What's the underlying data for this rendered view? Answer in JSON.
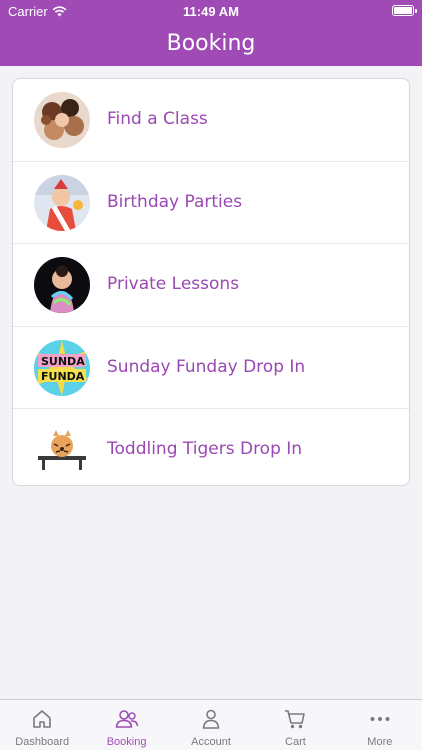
{
  "status_bar": {
    "carrier": "Carrier",
    "time": "11:49 AM"
  },
  "nav": {
    "title": "Booking"
  },
  "items": [
    {
      "label": "Find a Class",
      "icon": "kids-group-photo"
    },
    {
      "label": "Birthday Parties",
      "icon": "birthday-child-photo"
    },
    {
      "label": "Private Lessons",
      "icon": "dancer-photo"
    },
    {
      "label": "Sunday Funday Drop In",
      "icon": "sunday-funday-logo"
    },
    {
      "label": "Toddling Tigers Drop In",
      "icon": "toddling-tigers-logo"
    }
  ],
  "tabs": [
    {
      "label": "Dashboard",
      "icon": "home-icon"
    },
    {
      "label": "Booking",
      "icon": "people-icon",
      "active": true
    },
    {
      "label": "Account",
      "icon": "person-icon"
    },
    {
      "label": "Cart",
      "icon": "cart-icon"
    },
    {
      "label": "More",
      "icon": "more-icon"
    }
  ],
  "colors": {
    "brand": "#a04bb5",
    "background": "#f2f2f7",
    "tab_inactive": "#7a7a7e"
  }
}
